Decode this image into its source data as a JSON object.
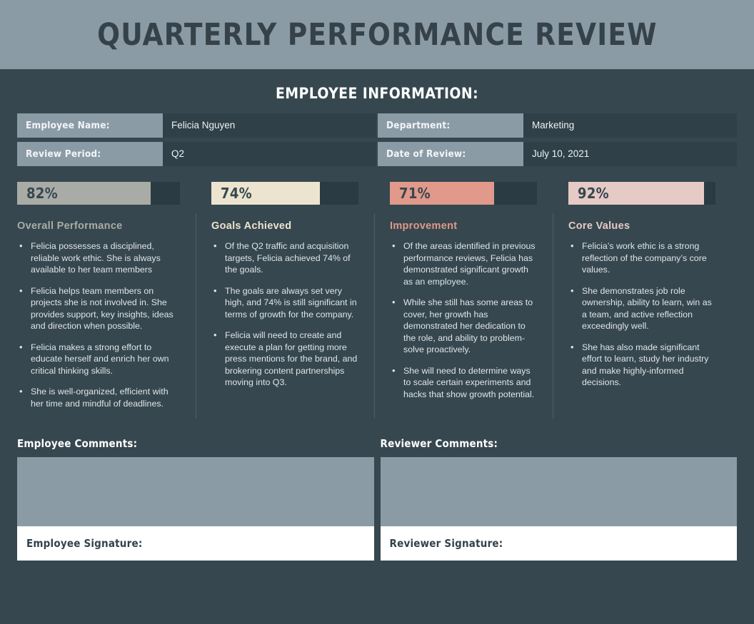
{
  "header": {
    "title": "QUARTERLY PERFORMANCE REVIEW"
  },
  "employee_info": {
    "section_title": "EMPLOYEE INFORMATION:",
    "fields": [
      {
        "label": "Employee Name:",
        "value": "Felicia Nguyen"
      },
      {
        "label": "Department:",
        "value": "Marketing"
      },
      {
        "label": "Review Period:",
        "value": "Q2"
      },
      {
        "label": "Date of Review:",
        "value": "July 10, 2021"
      }
    ]
  },
  "chart_data": {
    "type": "bar",
    "title": "",
    "categories": [
      "Overall Performance",
      "Goals Achieved",
      "Improvement",
      "Core Values"
    ],
    "values": [
      82,
      74,
      71,
      92
    ],
    "value_labels": [
      "82%",
      "74%",
      "71%",
      "92%"
    ],
    "ylim": [
      0,
      100
    ],
    "grid": false,
    "legend": "none",
    "orientation": "horizontal",
    "colors": [
      "#a9aca6",
      "#ece4cf",
      "#e0998a",
      "#e6cac5"
    ],
    "track_color": "#2b3b43"
  },
  "metrics": [
    {
      "pct": "82%",
      "value": 82,
      "color": "#a9aca6",
      "heading": "Overall Performance",
      "bullets": [
        "Felicia possesses a disciplined, reliable work ethic. She is always available to her team members",
        "Felicia helps team members on projects she is not involved in. She provides support, key insights, ideas and direction when possible.",
        "Felicia makes a strong effort to educate herself and enrich her own critical thinking skills.",
        "She is well-organized, efficient with her time and mindful of deadlines."
      ]
    },
    {
      "pct": "74%",
      "value": 74,
      "color": "#ece4cf",
      "heading": "Goals Achieved",
      "bullets": [
        "Of the Q2 traffic and acquisition targets, Felicia achieved 74% of the goals.",
        "The goals are always set very high, and 74% is still significant in terms of growth for the company.",
        "Felicia will need to create and execute a plan for getting more press mentions for the brand, and brokering content partnerships moving into Q3."
      ]
    },
    {
      "pct": "71%",
      "value": 71,
      "color": "#e0998a",
      "heading": "Improvement",
      "bullets": [
        "Of the areas identified in previous performance reviews, Felicia has demonstrated significant growth as an employee.",
        "While she still has some areas to cover, her growth has demonstrated her dedication to the role, and ability to problem-solve proactively.",
        "She will need to determine ways to scale certain experiments and hacks that show growth potential."
      ]
    },
    {
      "pct": "92%",
      "value": 92,
      "color": "#e6cac5",
      "heading": "Core Values",
      "bullets": [
        "Felicia’s work ethic is a strong reflection of the company’s core values.",
        "She demonstrates job role ownership, ability to learn, win as a team, and active reflection exceedingly well.",
        "She has also made significant effort to learn, study her industry and make highly-informed decisions."
      ]
    }
  ],
  "comments": [
    {
      "label": "Employee Comments:",
      "value": "",
      "signature_label": "Employee Signature:",
      "signature_value": ""
    },
    {
      "label": "Reviewer Comments:",
      "value": "",
      "signature_label": "Reviewer Signature:",
      "signature_value": ""
    }
  ]
}
